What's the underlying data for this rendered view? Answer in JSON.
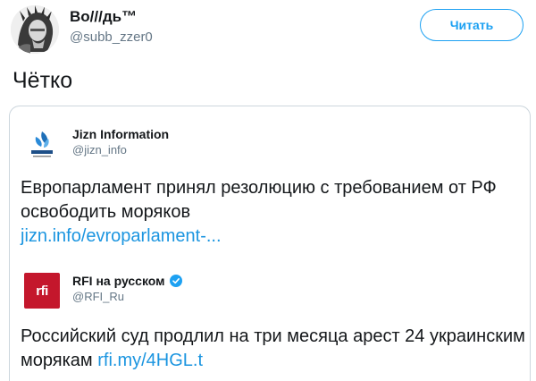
{
  "user": {
    "name": "Bo///дь™",
    "handle": "@subb_zzer0"
  },
  "follow_button": {
    "label": "Читать"
  },
  "tweet": {
    "text": "Чётко"
  },
  "quoted": {
    "author_name": "Jizn Information",
    "author_handle": "@jizn_info",
    "text": "Европарламент принял резолюцию с требованием от РФ освободить моряков",
    "link": "jizn.info/evroparlament-..."
  },
  "nested_quote": {
    "author_name": "RFI на русском",
    "author_handle": "@RFI_Ru",
    "avatar_text": "rfi",
    "text": "Российский суд продлил на три месяца арест 24 украинским морякам",
    "link": "rfi.my/4HGL.t",
    "verified": true
  },
  "colors": {
    "accent": "#1da1f2",
    "link": "#1b95e0",
    "rfi_red": "#c4172c"
  }
}
